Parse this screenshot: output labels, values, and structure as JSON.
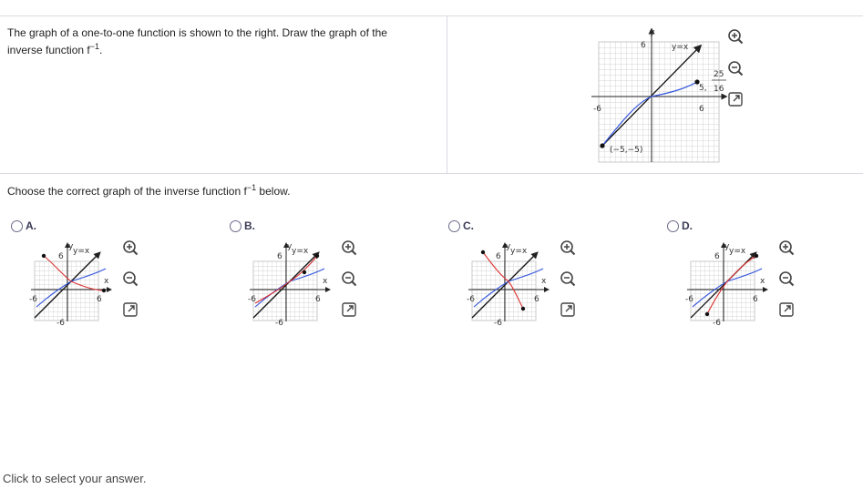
{
  "question": {
    "prompt_part1": "The graph of a one-to-one function is shown to the right. Draw the graph of the",
    "prompt_part2": "inverse function f",
    "prompt_sup": "−1",
    "prompt_end": "."
  },
  "main_graph": {
    "y_axis_label": "y",
    "y_tick": "6",
    "x_tick_neg": "-6",
    "x_tick_pos": "6",
    "line_label": "y=x",
    "point_label_x": "5,",
    "frac_num": "25",
    "frac_den": "16",
    "point2_label": "(−5,−5)",
    "curve_color": "#3355dd",
    "line_color": "#111111"
  },
  "instruction": {
    "text": "Choose the correct graph of the inverse function f",
    "sup": "−1",
    "after": " below."
  },
  "choices": [
    {
      "label": "A.",
      "y_tick": "6",
      "y_tick_neg": "-6",
      "x_tick_neg": "-6",
      "x_tick_pos": "6",
      "y_axis_label": "y",
      "x_axis_label": "x",
      "line_label": "y=x"
    },
    {
      "label": "B.",
      "y_tick": "6",
      "y_tick_neg": "-6",
      "x_tick_neg": "-6",
      "x_tick_pos": "6",
      "y_axis_label": "y",
      "x_axis_label": "x",
      "line_label": "y=x"
    },
    {
      "label": "C.",
      "y_tick": "6",
      "y_tick_neg": "-6",
      "x_tick_neg": "-6",
      "x_tick_pos": "6",
      "y_axis_label": "y",
      "x_axis_label": "x",
      "line_label": "y=x"
    },
    {
      "label": "D.",
      "y_tick": "6",
      "y_tick_neg": "-6",
      "x_tick_neg": "-6",
      "x_tick_pos": "6",
      "y_axis_label": "y",
      "x_axis_label": "x",
      "line_label": "y=x"
    }
  ],
  "colors": {
    "inverse_curve": "#dd3333",
    "original_curve": "#3355dd",
    "accent": "#3a3a55"
  },
  "footer": {
    "status": "Click to select your answer."
  },
  "icons": {
    "zoom_in": "zoom-in-icon",
    "zoom_out": "zoom-out-icon",
    "popout": "popout-icon"
  }
}
